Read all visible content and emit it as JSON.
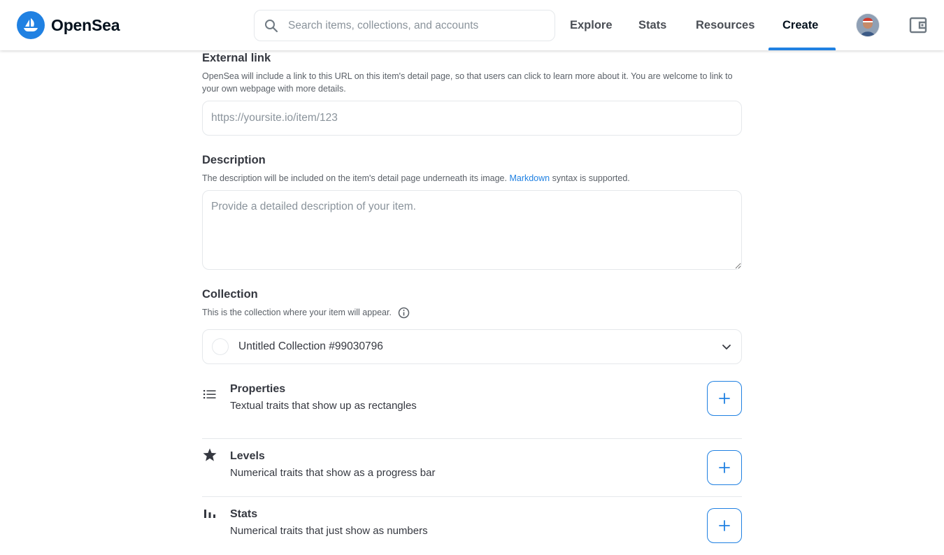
{
  "brand": {
    "name": "OpenSea",
    "color": "#2081e2"
  },
  "search": {
    "placeholder": "Search items, collections, and accounts",
    "value": ""
  },
  "nav": {
    "items": [
      {
        "label": "Explore"
      },
      {
        "label": "Stats"
      },
      {
        "label": "Resources"
      },
      {
        "label": "Create",
        "active": true
      }
    ]
  },
  "form": {
    "external_link": {
      "label": "External link",
      "caption": "OpenSea will include a link to this URL on this item's detail page, so that users can click to learn more about it. You are welcome to link to your own webpage with more details.",
      "placeholder": "https://yoursite.io/item/123",
      "value": ""
    },
    "description": {
      "label": "Description",
      "caption_before": "The description will be included on the item's detail page underneath its image. ",
      "caption_link": "Markdown",
      "caption_after": " syntax is supported.",
      "placeholder": "Provide a detailed description of your item.",
      "value": ""
    },
    "collection": {
      "label": "Collection",
      "caption": "This is the collection where your item will appear.",
      "selected": "Untitled Collection #99030796",
      "info_icon": "info-icon",
      "chevron_icon": "chevron-down-icon"
    },
    "traits": [
      {
        "title": "Properties",
        "description": "Textual traits that show up as rectangles",
        "icon": "list-icon"
      },
      {
        "title": "Levels",
        "description": "Numerical traits that show as a progress bar",
        "icon": "star-icon"
      },
      {
        "title": "Stats",
        "description": "Numerical traits that just show as numbers",
        "icon": "bar-chart-icon"
      }
    ]
  }
}
